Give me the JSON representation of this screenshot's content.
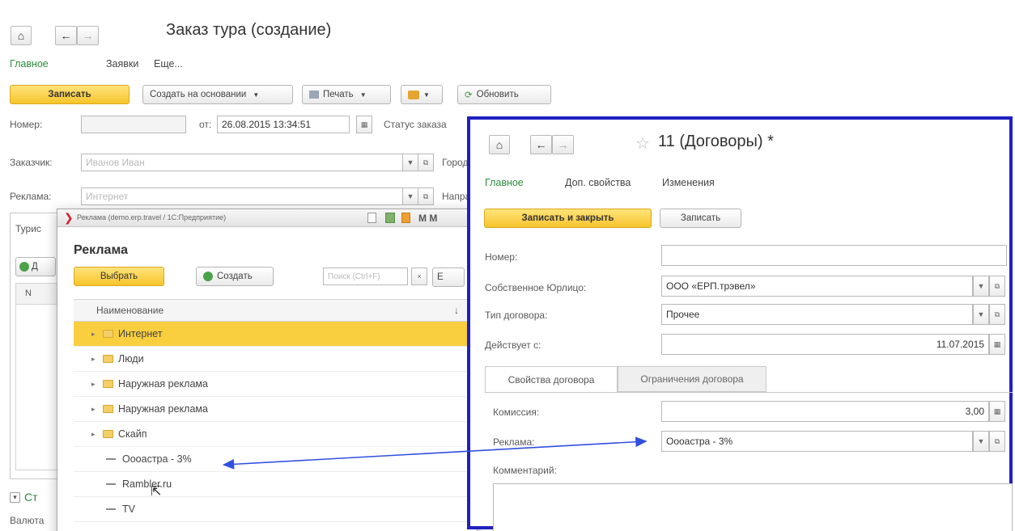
{
  "order_form": {
    "title": "Заказ тура (создание)",
    "nav": {
      "home": "⌂",
      "back": "←",
      "forward": "→"
    },
    "tabs": [
      "Главное",
      "Заявки",
      "Еще..."
    ],
    "toolbar": {
      "write": "Записать",
      "create_based": "Создать на основании",
      "print": "Печать",
      "refresh": "Обновить"
    },
    "fields": {
      "number_label": "Номер:",
      "from_label": "от:",
      "date_value": "26.08.2015 13:34:51",
      "status_label": "Статус заказа",
      "customer_label": "Заказчик:",
      "customer_placeholder": "Иванов Иван",
      "city_label": "Город в",
      "ad_label": "Реклама:",
      "ad_placeholder": "Интернет",
      "direction_label": "Направ"
    },
    "panel": {
      "tab_label": "Турис",
      "add_label": "Д",
      "col_n": "N",
      "section_label": "Ст",
      "currency_label": "Валюта"
    }
  },
  "ads_window": {
    "titlebar": "Реклама (demo.erp.travel / 1С:Предприятие)",
    "titlebar_right": "M M",
    "heading": "Реклама",
    "select_button": "Выбрать",
    "create_button": "Создать",
    "search_placeholder": "Поиск (Ctrl+F)",
    "search_extra": "E",
    "column_header": "Наименование",
    "column_sort": "↓",
    "rows": [
      {
        "label": "Интернет",
        "kind": "folder",
        "selected": true
      },
      {
        "label": "Люди",
        "kind": "folder",
        "selected": false
      },
      {
        "label": "Наружная реклама",
        "kind": "folder",
        "selected": false
      },
      {
        "label": "Наружная реклама",
        "kind": "folder",
        "selected": false
      },
      {
        "label": "Скайп",
        "kind": "folder",
        "selected": false
      },
      {
        "label": "Оооастра - 3%",
        "kind": "item",
        "selected": false
      },
      {
        "label": "Rambler.ru",
        "kind": "item",
        "selected": false
      },
      {
        "label": "TV",
        "kind": "item",
        "selected": false
      }
    ]
  },
  "contract_window": {
    "title": "11 (Договоры) *",
    "tabs": [
      "Главное",
      "Доп. свойства",
      "Изменения"
    ],
    "save_close": "Записать и закрыть",
    "save": "Записать",
    "fields": {
      "number_label": "Номер:",
      "number_value": "",
      "company_label": "Собственное Юрлицо:",
      "company_value": "ООО «ЕРП.трэвел»",
      "type_label": "Тип договора:",
      "type_value": "Прочее",
      "valid_label": "Действует с:",
      "valid_value": "11.07.2015"
    },
    "inner_tabs": [
      "Свойства договора",
      "Ограничения договора"
    ],
    "commission_label": "Комиссия:",
    "commission_value": "3,00",
    "ad_label": "Реклама:",
    "ad_value": "Оооастра - 3%",
    "comment_label": "Комментарий:"
  },
  "colors": {
    "accent_green": "#2e8b3d",
    "button_yellow": "#f7c52c",
    "selected_row": "#f9cf3f",
    "highlight_border": "#2020c0",
    "arrow": "#3050e0"
  }
}
